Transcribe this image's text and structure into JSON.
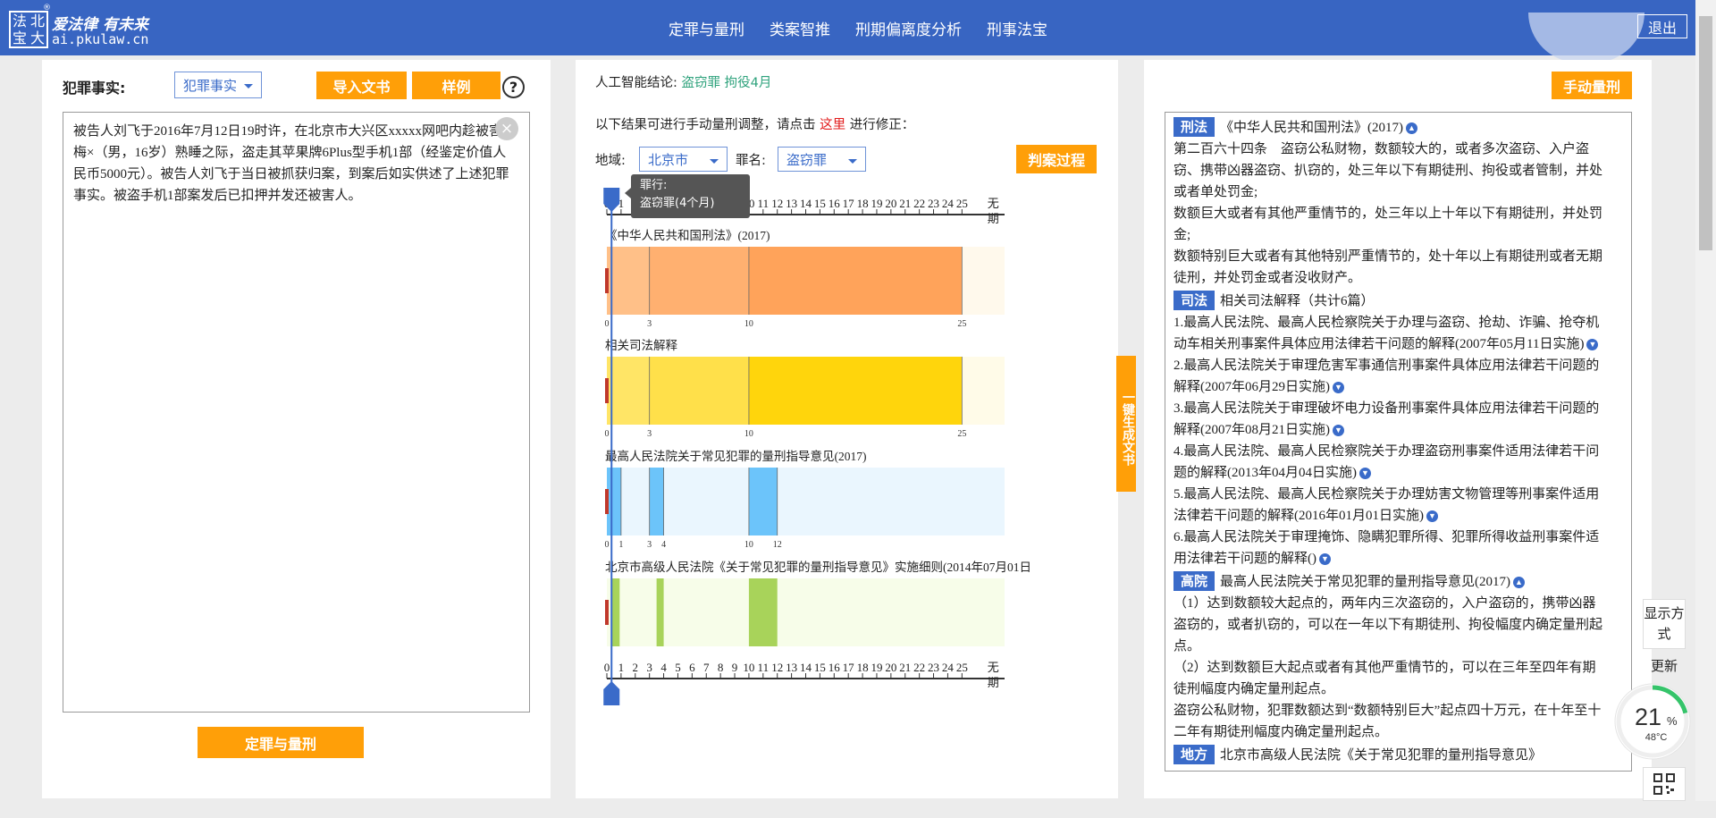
{
  "header": {
    "logo_chars": [
      "法",
      "北",
      "宝",
      "大"
    ],
    "slogan": "爱法律 有未来",
    "url": "ai.pkulaw.cn",
    "registered": "®",
    "nav": [
      "定罪与量刑",
      "类案智推",
      "刑期偏离度分析",
      "刑事法宝"
    ],
    "logout": "退出"
  },
  "left": {
    "facts_label": "犯罪事实:",
    "select_value": "犯罪事实",
    "import_btn": "导入文书",
    "sample_btn": "样例",
    "help": "?",
    "facts_text": "被告人刘飞于2016年7月12日19时许，在北京市大兴区xxxxx网吧内趁被害人梅×（男，16岁）熟睡之际，盗走其苹果牌6Plus型手机1部（经鉴定价值人民币5000元）。被告人刘飞于当日被抓获归案，到案后如实供述了上述犯罪事实。被盗手机1部案发后已扣押并发还被害人。",
    "clear": "×",
    "submit_btn": "定罪与量刑"
  },
  "middle": {
    "ai_label": "人工智能结论:",
    "ai_result": "盗窃罪 拘役4月",
    "hint_pre": "以下结果可进行手动量刑调整，请点击",
    "hint_link": "这里",
    "hint_post": "进行修正：",
    "region_label": "地域:",
    "region_value": "北京市",
    "crime_label": "罪名:",
    "crime_value": "盗窃罪",
    "process_btn": "判案过程",
    "tooltip_title": "罪行:",
    "tooltip_value": "盗窃罪(4个月)",
    "vertical_btn": "一键生成文书"
  },
  "chart_data": {
    "type": "bar",
    "xlabel": "",
    "x_ticks": [
      "0",
      "1",
      "2",
      "3",
      "4",
      "5",
      "6",
      "7",
      "8",
      "9",
      "10",
      "11",
      "12",
      "13",
      "14",
      "15",
      "16",
      "17",
      "18",
      "19",
      "20",
      "21",
      "22",
      "23",
      "24",
      "25"
    ],
    "x_end_label": "无期",
    "xlim": [
      0,
      28
    ],
    "marker_value": 0.33,
    "series": [
      {
        "name": "《中华人民共和国刑法》(2017)",
        "ticks": [
          0,
          3,
          10,
          25
        ],
        "segments": [
          {
            "from": 0,
            "to": 3,
            "color": "#ffc088"
          },
          {
            "from": 3,
            "to": 10,
            "color": "#ffb070"
          },
          {
            "from": 10,
            "to": 25,
            "color": "#ffa35a"
          },
          {
            "from": 25,
            "to": 28,
            "color": "#fff9ec"
          }
        ]
      },
      {
        "name": "相关司法解释",
        "ticks": [
          0,
          3,
          10,
          25
        ],
        "segments": [
          {
            "from": 0,
            "to": 3,
            "color": "#ffe566"
          },
          {
            "from": 3,
            "to": 10,
            "color": "#ffe04a"
          },
          {
            "from": 10,
            "to": 25,
            "color": "#ffd50c"
          },
          {
            "from": 25,
            "to": 28,
            "color": "#fffbe8"
          }
        ]
      },
      {
        "name": "最高人民法院关于常见犯罪的量刑指导意见(2017)",
        "ticks": [
          0,
          1,
          3,
          4,
          10,
          12
        ],
        "segments": [
          {
            "from": 0,
            "to": 28,
            "color": "#eaf6fe"
          },
          {
            "from": 0,
            "to": 1,
            "color": "#6cc4fa"
          },
          {
            "from": 3,
            "to": 4,
            "color": "#6cc4fa"
          },
          {
            "from": 10,
            "to": 12,
            "color": "#6cc4fa"
          }
        ]
      },
      {
        "name": "北京市高级人民法院《关于常见犯罪的量刑指导意见》实施细则(2014年07月01日",
        "ticks": [],
        "segments": [
          {
            "from": 0,
            "to": 28,
            "color": "#f7fde9"
          },
          {
            "from": 0.3,
            "to": 0.9,
            "color": "#a8d35a"
          },
          {
            "from": 3.5,
            "to": 4,
            "color": "#a8d35a"
          },
          {
            "from": 10,
            "to": 12,
            "color": "#a8d35a"
          }
        ]
      }
    ]
  },
  "right": {
    "manual_btn": "手动量刑",
    "xingfa_tag": "刑法",
    "xingfa_title": "《中华人民共和国刑法》(2017)",
    "article": [
      "第二百六十四条　盗窃公私财物，数额较大的，或者多次盗窃、入户盗窃、携带凶器盗窃、扒窃的，处三年以下有期徒刑、拘役或者管制，并处或者单处罚金;",
      "数额巨大或者有其他严重情节的，处三年以上十年以下有期徒刑，并处罚金;",
      "数额特别巨大或者有其他特别严重情节的，处十年以上有期徒刑或者无期徒刑，并处罚金或者没收财产。"
    ],
    "sifa_tag": "司法",
    "sifa_title": "相关司法解释（共计6篇）",
    "interpretations": [
      "1.最高人民法院、最高人民检察院关于办理与盗窃、抢劫、诈骗、抢夺机动车相关刑事案件具体应用法律若干问题的解释(2007年05月11日实施)",
      "2.最高人民法院关于审理危害军事通信刑事案件具体应用法律若干问题的解释(2007年06月29日实施)",
      "3.最高人民法院关于审理破坏电力设备刑事案件具体应用法律若干问题的解释(2007年08月21日实施)",
      "4.最高人民法院、最高人民检察院关于办理盗窃刑事案件适用法律若干问题的解释(2013年04月04日实施)",
      "5.最高人民法院、最高人民检察院关于办理妨害文物管理等刑事案件适用法律若干问题的解释(2016年01月01日实施)",
      "6.最高人民法院关于审理掩饰、隐瞒犯罪所得、犯罪所得收益刑事案件适用法律若干问题的解释()"
    ],
    "gaoyuan_tag": "高院",
    "gaoyuan_title": "最高人民法院关于常见犯罪的量刑指导意见(2017)",
    "gaoyuan_items": [
      "（1）达到数额较大起点的，两年内三次盗窃的，入户盗窃的，携带凶器盗窃的，或者扒窃的，可以在一年以下有期徒刑、拘役幅度内确定量刑起点。",
      "（2）达到数额巨大起点或者有其他严重情节的，可以在三年至四年有期徒刑幅度内确定量刑起点。",
      "盗窃公私财物，犯罪数额达到“数额特别巨大”起点四十万元，在十年至十二年有期徒刑幅度内确定量刑起点。"
    ],
    "difang_tag": "地方",
    "difang_title": "北京市高级人民法院《关于常见犯罪的量刑指导意见》"
  },
  "side": {
    "display_mode": "显示方式",
    "refresh": "更新",
    "gauge_percent": "21",
    "gauge_unit": "%",
    "gauge_temp": "48°C",
    "gauge_level": 0.21
  }
}
